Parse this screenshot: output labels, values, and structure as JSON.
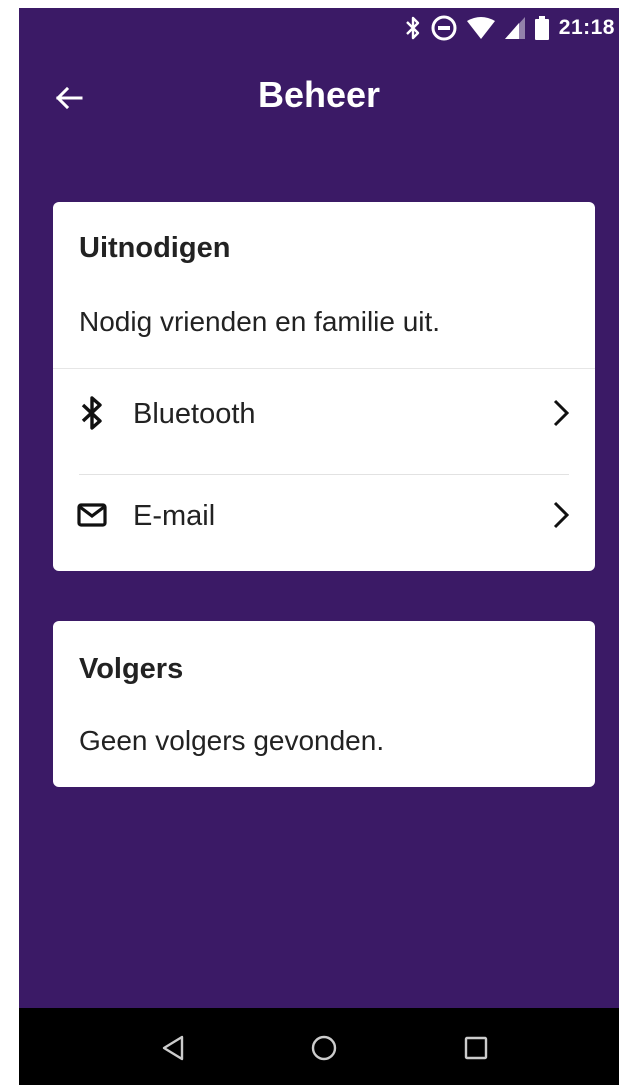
{
  "status_bar": {
    "time": "21:18",
    "icons": [
      "bluetooth-icon",
      "do-not-disturb-icon",
      "wifi-icon",
      "cell-signal-icon",
      "battery-icon"
    ]
  },
  "app_bar": {
    "title": "Beheer",
    "back_icon": "arrow-left-icon"
  },
  "invite_card": {
    "title": "Uitnodigen",
    "description": "Nodig vrienden en familie uit.",
    "options": [
      {
        "label": "Bluetooth",
        "icon": "bluetooth-icon"
      },
      {
        "label": "E-mail",
        "icon": "mail-icon"
      }
    ]
  },
  "followers_card": {
    "title": "Volgers",
    "empty_text": "Geen volgers gevonden."
  },
  "nav_bar": {
    "icons": [
      "back-triangle-icon",
      "home-circle-icon",
      "recents-square-icon"
    ]
  },
  "colors": {
    "background": "#3b1a66",
    "card": "#ffffff",
    "text": "#222222",
    "nav_bar": "#000000"
  }
}
